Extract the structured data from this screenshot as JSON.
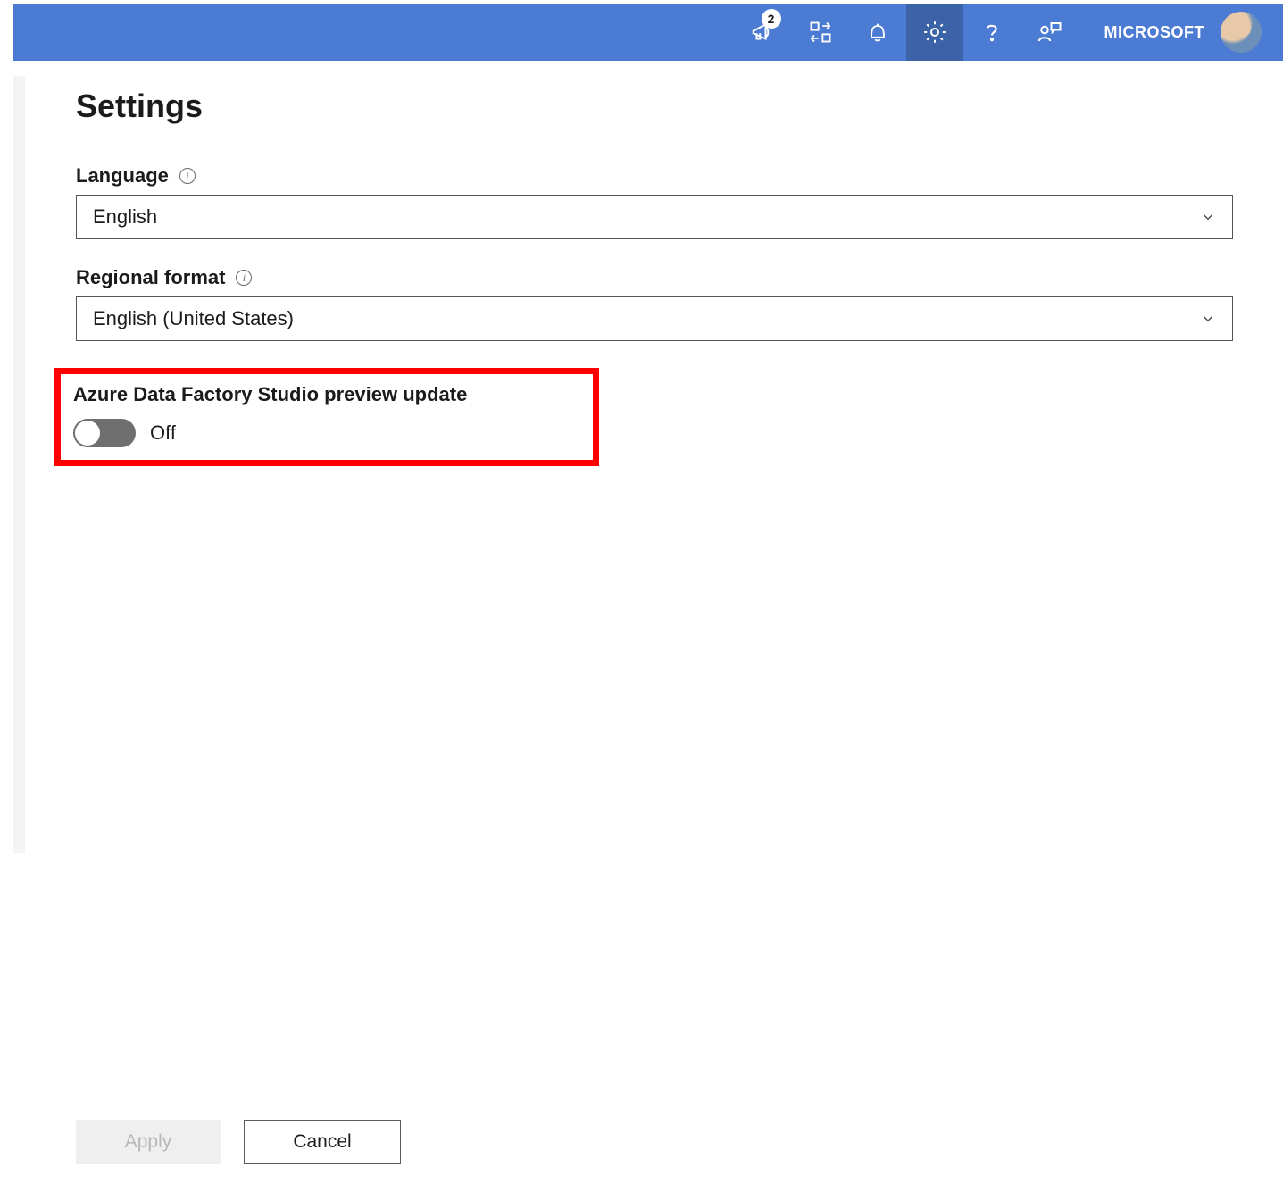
{
  "header": {
    "megaphone_badge": "2",
    "tenant_label": "MICROSOFT"
  },
  "page": {
    "title": "Settings"
  },
  "language": {
    "label": "Language",
    "value": "English"
  },
  "regional": {
    "label": "Regional format",
    "value": "English (United States)"
  },
  "preview": {
    "label": "Azure Data Factory Studio preview update",
    "state": "Off"
  },
  "footer": {
    "apply": "Apply",
    "cancel": "Cancel"
  }
}
